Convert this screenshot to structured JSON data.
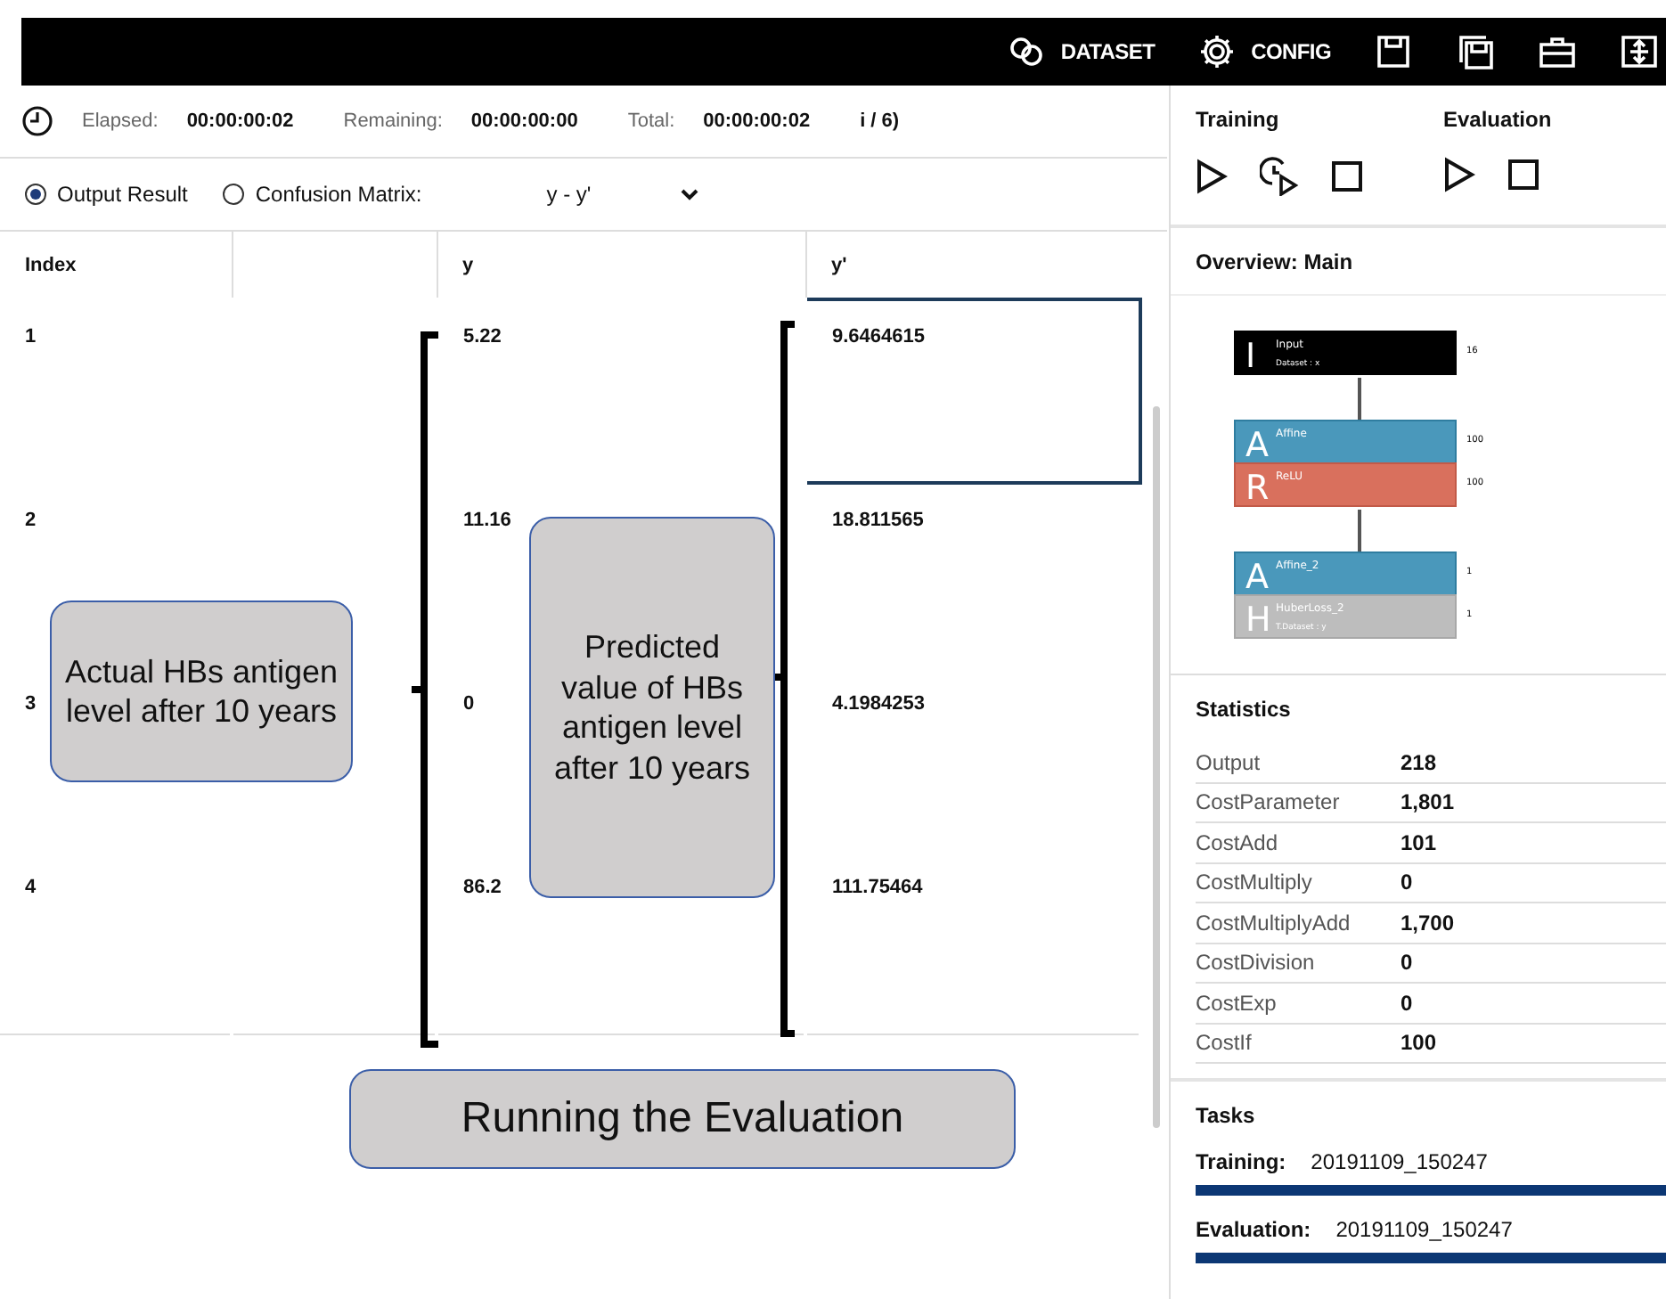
{
  "toolbar": {
    "items": [
      {
        "kind": "link",
        "label": "DATASET"
      },
      {
        "kind": "gear",
        "label": "CONFIG"
      },
      {
        "kind": "save"
      },
      {
        "kind": "saveas"
      },
      {
        "kind": "toolbox"
      },
      {
        "kind": "fit"
      }
    ]
  },
  "timing": {
    "elapsed_label": "Elapsed:",
    "elapsed": "00:00:00:02",
    "remaining_label": "Remaining:",
    "remaining": "00:00:00:00",
    "total_label": "Total:",
    "total": "00:00:00:02",
    "epoch_fragment": "i / 6)"
  },
  "view_options": [
    {
      "label": "Output Result",
      "selected": true
    },
    {
      "label": "Confusion Matrix:",
      "selected": false
    }
  ],
  "matrix_select": {
    "value": "y - y'"
  },
  "table": {
    "columns": [
      "Index",
      "",
      "y",
      "y'"
    ],
    "rows": [
      {
        "cells": [
          "1",
          "",
          "5.22",
          "9.6464615"
        ],
        "selected": true
      },
      {
        "cells": [
          "2",
          "",
          "11.16",
          "18.811565"
        ],
        "selected": false
      },
      {
        "cells": [
          "3",
          "",
          "0",
          "4.1984253"
        ],
        "selected": false
      },
      {
        "cells": [
          "4",
          "",
          "86.2",
          "111.75464"
        ],
        "selected": false
      }
    ]
  },
  "callouts": [
    "Actual HBs antigen level after 10 years",
    "Predicted value of HBs antigen level after 10 years",
    "Running the Evaluation"
  ],
  "side": {
    "training_title": "Training",
    "evaluation_title": "Evaluation",
    "overview_title": "Overview: Main",
    "network": [
      {
        "kind": "input",
        "letter": "I",
        "name": "Input",
        "sub": "Dataset : x",
        "size": "16"
      },
      {
        "kind": "affine",
        "letter": "A",
        "name": "Affine",
        "size": "100"
      },
      {
        "kind": "relu",
        "letter": "R",
        "name": "ReLU",
        "size": "100"
      },
      {
        "kind": "affine",
        "letter": "A",
        "name": "Affine_2",
        "size": "1"
      },
      {
        "kind": "loss",
        "letter": "H",
        "name": "HuberLoss_2",
        "sub": "T.Dataset : y",
        "size": "1"
      }
    ],
    "statistics_title": "Statistics",
    "statistics": [
      {
        "name": "Output",
        "value": "218"
      },
      {
        "name": "CostParameter",
        "value": "1,801"
      },
      {
        "name": "CostAdd",
        "value": "101"
      },
      {
        "name": "CostMultiply",
        "value": "0"
      },
      {
        "name": "CostMultiplyAdd",
        "value": "1,700"
      },
      {
        "name": "CostDivision",
        "value": "0"
      },
      {
        "name": "CostExp",
        "value": "0"
      },
      {
        "name": "CostIf",
        "value": "100"
      }
    ],
    "tasks_title": "Tasks",
    "tasks": [
      {
        "label": "Training:",
        "value": "20191109_150247",
        "level": 1
      },
      {
        "label": "Evaluation:",
        "value": "20191109_150247",
        "level": 1
      }
    ]
  }
}
